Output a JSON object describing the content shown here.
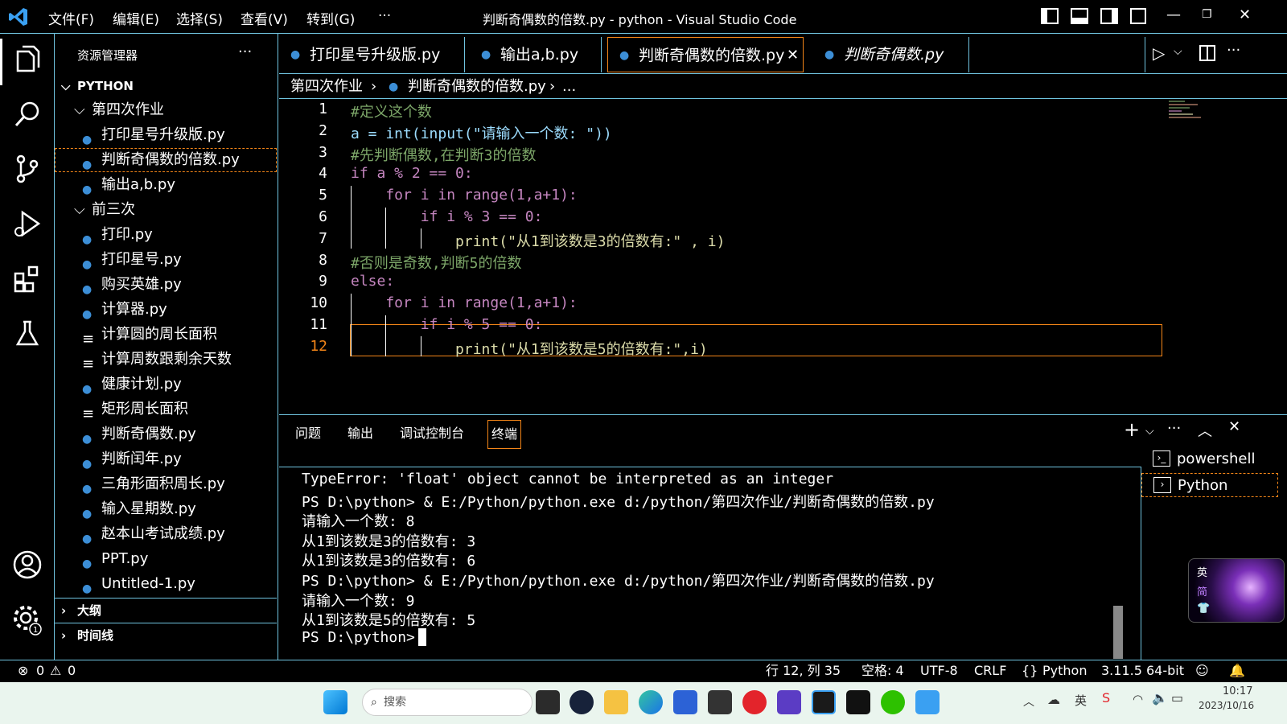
{
  "titlebar": {
    "menus": [
      "文件(F)",
      "编辑(E)",
      "选择(S)",
      "查看(V)",
      "转到(G)",
      "···"
    ],
    "title": "判断奇偶数的倍数.py - python - Visual Studio Code"
  },
  "sidebar": {
    "header": "资源管理器",
    "more": "···",
    "root": "PYTHON",
    "folder1": "第四次作业",
    "folder1_files": [
      "打印星号升级版.py",
      "判断奇偶数的倍数.py",
      "输出a,b.py"
    ],
    "folder2": "前三次",
    "folder2_files": [
      {
        "name": "打印.py",
        "type": "py"
      },
      {
        "name": "打印星号.py",
        "type": "py"
      },
      {
        "name": "购买英雄.py",
        "type": "py"
      },
      {
        "name": "计算器.py",
        "type": "py"
      },
      {
        "name": "计算圆的周长面积",
        "type": "txt"
      },
      {
        "name": "计算周数跟剩余天数",
        "type": "txt"
      },
      {
        "name": "健康计划.py",
        "type": "py"
      },
      {
        "name": "矩形周长面积",
        "type": "txt"
      },
      {
        "name": "判断奇偶数.py",
        "type": "py"
      },
      {
        "name": "判断闰年.py",
        "type": "py"
      },
      {
        "name": "三角形面积周长.py",
        "type": "py"
      },
      {
        "name": "输入星期数.py",
        "type": "py"
      },
      {
        "name": "赵本山考试成绩.py",
        "type": "py"
      },
      {
        "name": "PPT.py",
        "type": "py"
      },
      {
        "name": "Untitled-1.py",
        "type": "py"
      }
    ],
    "outline": "大纲",
    "timeline": "时间线"
  },
  "tabs": [
    "打印星号升级版.py",
    "输出a,b.py",
    "判断奇偶数的倍数.py",
    "判断奇偶数.py"
  ],
  "breadcrumb": {
    "folder": "第四次作业",
    "file": "判断奇偶数的倍数.py",
    "more": "..."
  },
  "editor": {
    "line_numbers": [
      "1",
      "2",
      "3",
      "4",
      "5",
      "6",
      "7",
      "8",
      "9",
      "10",
      "11",
      "12"
    ],
    "lines": [
      "#定义这个数",
      "a = int(input(\"请输入一个数: \"))",
      "#先判断偶数,在判断3的倍数",
      "if a % 2 == 0:",
      "    for i in range(1,a+1):",
      "        if i % 3 == 0:",
      "            print(\"从1到该数是3的倍数有:\" , i)",
      "#否则是奇数,判断5的倍数",
      "else:",
      "    for i in range(1,a+1):",
      "        if i % 5 == 0:",
      "            print(\"从1到该数是5的倍数有:\",i)"
    ]
  },
  "panel": {
    "tabs": [
      "问题",
      "输出",
      "调试控制台",
      "终端"
    ],
    "terminal_lines": [
      "TypeError: 'float' object cannot be interpreted as an integer",
      "PS D:\\python> & E:/Python/python.exe d:/python/第四次作业/判断奇偶数的倍数.py",
      "请输入一个数: 8",
      "从1到该数是3的倍数有: 3",
      "从1到该数是3的倍数有: 6",
      "PS D:\\python> & E:/Python/python.exe d:/python/第四次作业/判断奇偶数的倍数.py",
      "请输入一个数: 9",
      "从1到该数是5的倍数有: 5",
      "PS D:\\python> "
    ],
    "terminals": [
      "powershell",
      "Python"
    ]
  },
  "statusbar": {
    "errors": "0",
    "warnings": "0",
    "position": "行 12, 列 35",
    "spaces": "空格: 4",
    "encoding": "UTF-8",
    "eol": "CRLF",
    "language": "Python",
    "interpreter": "3.11.5 64-bit"
  },
  "taskbar": {
    "search": "搜索",
    "ime1": "英",
    "ime2": "简",
    "tray_lang": "英",
    "time": "10:17",
    "date": "2023/10/16"
  }
}
